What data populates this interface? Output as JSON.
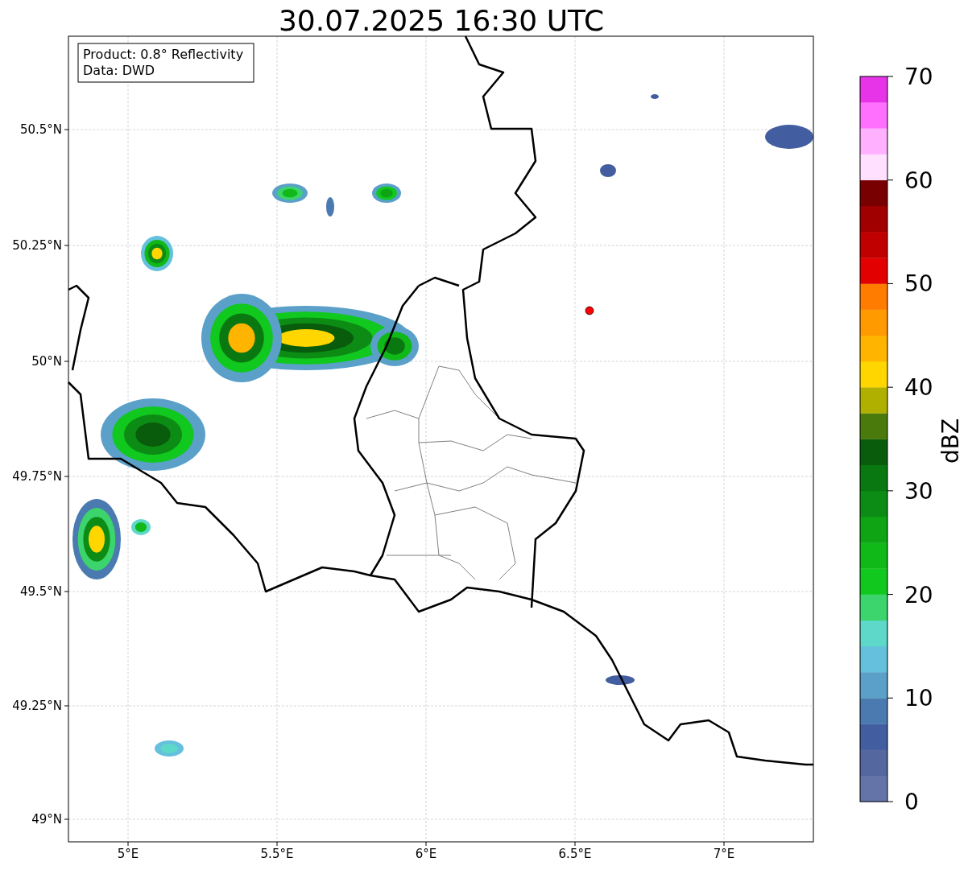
{
  "title": "30.07.2025 16:30 UTC",
  "info_box": {
    "lines": [
      "Product: 0.8° Reflectivity",
      "Data: DWD"
    ]
  },
  "map": {
    "x_ticks": [
      "5°E",
      "5.5°E",
      "6°E",
      "6.5°E",
      "7°E"
    ],
    "y_ticks": [
      "50.5°N",
      "50.25°N",
      "50°N",
      "49.75°N",
      "49.5°N",
      "49.25°N",
      "49°N"
    ],
    "radar_site": {
      "color": "#ff0000"
    }
  },
  "colorbar": {
    "label": "dBZ",
    "ticks": [
      "70",
      "60",
      "50",
      "40",
      "30",
      "20",
      "10",
      "0"
    ],
    "bins": [
      {
        "color": "#6474a8"
      },
      {
        "color": "#54689f"
      },
      {
        "color": "#425ea0"
      },
      {
        "color": "#4a7ab0"
      },
      {
        "color": "#5aa0c8"
      },
      {
        "color": "#64c0dc"
      },
      {
        "color": "#5ed8c8"
      },
      {
        "color": "#3cd46c"
      },
      {
        "color": "#10c81e"
      },
      {
        "color": "#10b818"
      },
      {
        "color": "#0ea414"
      },
      {
        "color": "#0c8c14"
      },
      {
        "color": "#0a7810"
      },
      {
        "color": "#085c0c"
      },
      {
        "color": "#4a7a0c"
      },
      {
        "color": "#b0b000"
      },
      {
        "color": "#ffd600"
      },
      {
        "color": "#ffb400"
      },
      {
        "color": "#ff9a00"
      },
      {
        "color": "#ff7c00"
      },
      {
        "color": "#e20000"
      },
      {
        "color": "#c00000"
      },
      {
        "color": "#a00000"
      },
      {
        "color": "#780000"
      },
      {
        "color": "#ffe0ff"
      },
      {
        "color": "#ffb0ff"
      },
      {
        "color": "#ff70ff"
      },
      {
        "color": "#e834e8"
      }
    ]
  }
}
